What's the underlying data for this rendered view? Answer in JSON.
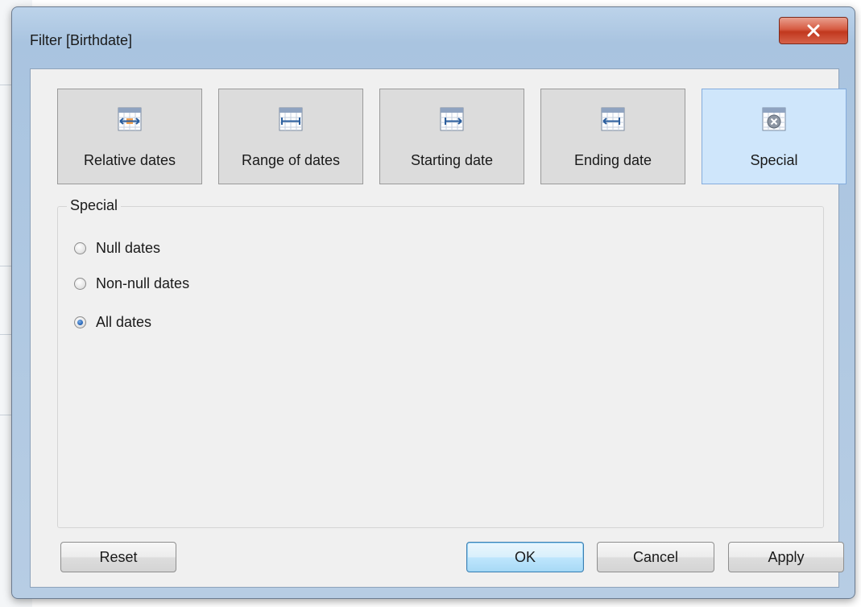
{
  "window": {
    "title": "Filter [Birthdate]",
    "close_glyph": "✕"
  },
  "categories": [
    {
      "label": "Relative dates",
      "icon": "relative-dates-icon",
      "selected": false
    },
    {
      "label": "Range of dates",
      "icon": "range-of-dates-icon",
      "selected": false
    },
    {
      "label": "Starting date",
      "icon": "starting-date-icon",
      "selected": false
    },
    {
      "label": "Ending date",
      "icon": "ending-date-icon",
      "selected": false
    },
    {
      "label": "Special",
      "icon": "special-date-icon",
      "selected": true
    }
  ],
  "special": {
    "legend": "Special",
    "options": [
      {
        "label": "Null dates",
        "checked": false
      },
      {
        "label": "Non-null dates",
        "checked": false
      },
      {
        "label": "All dates",
        "checked": true
      }
    ]
  },
  "buttons": {
    "reset": "Reset",
    "ok": "OK",
    "cancel": "Cancel",
    "apply": "Apply"
  },
  "colors": {
    "selected_tile": "#cfe6fb",
    "tile": "#dcdcdc",
    "close_button": "#c1381e",
    "radio_checked": "#1f5fb3"
  }
}
